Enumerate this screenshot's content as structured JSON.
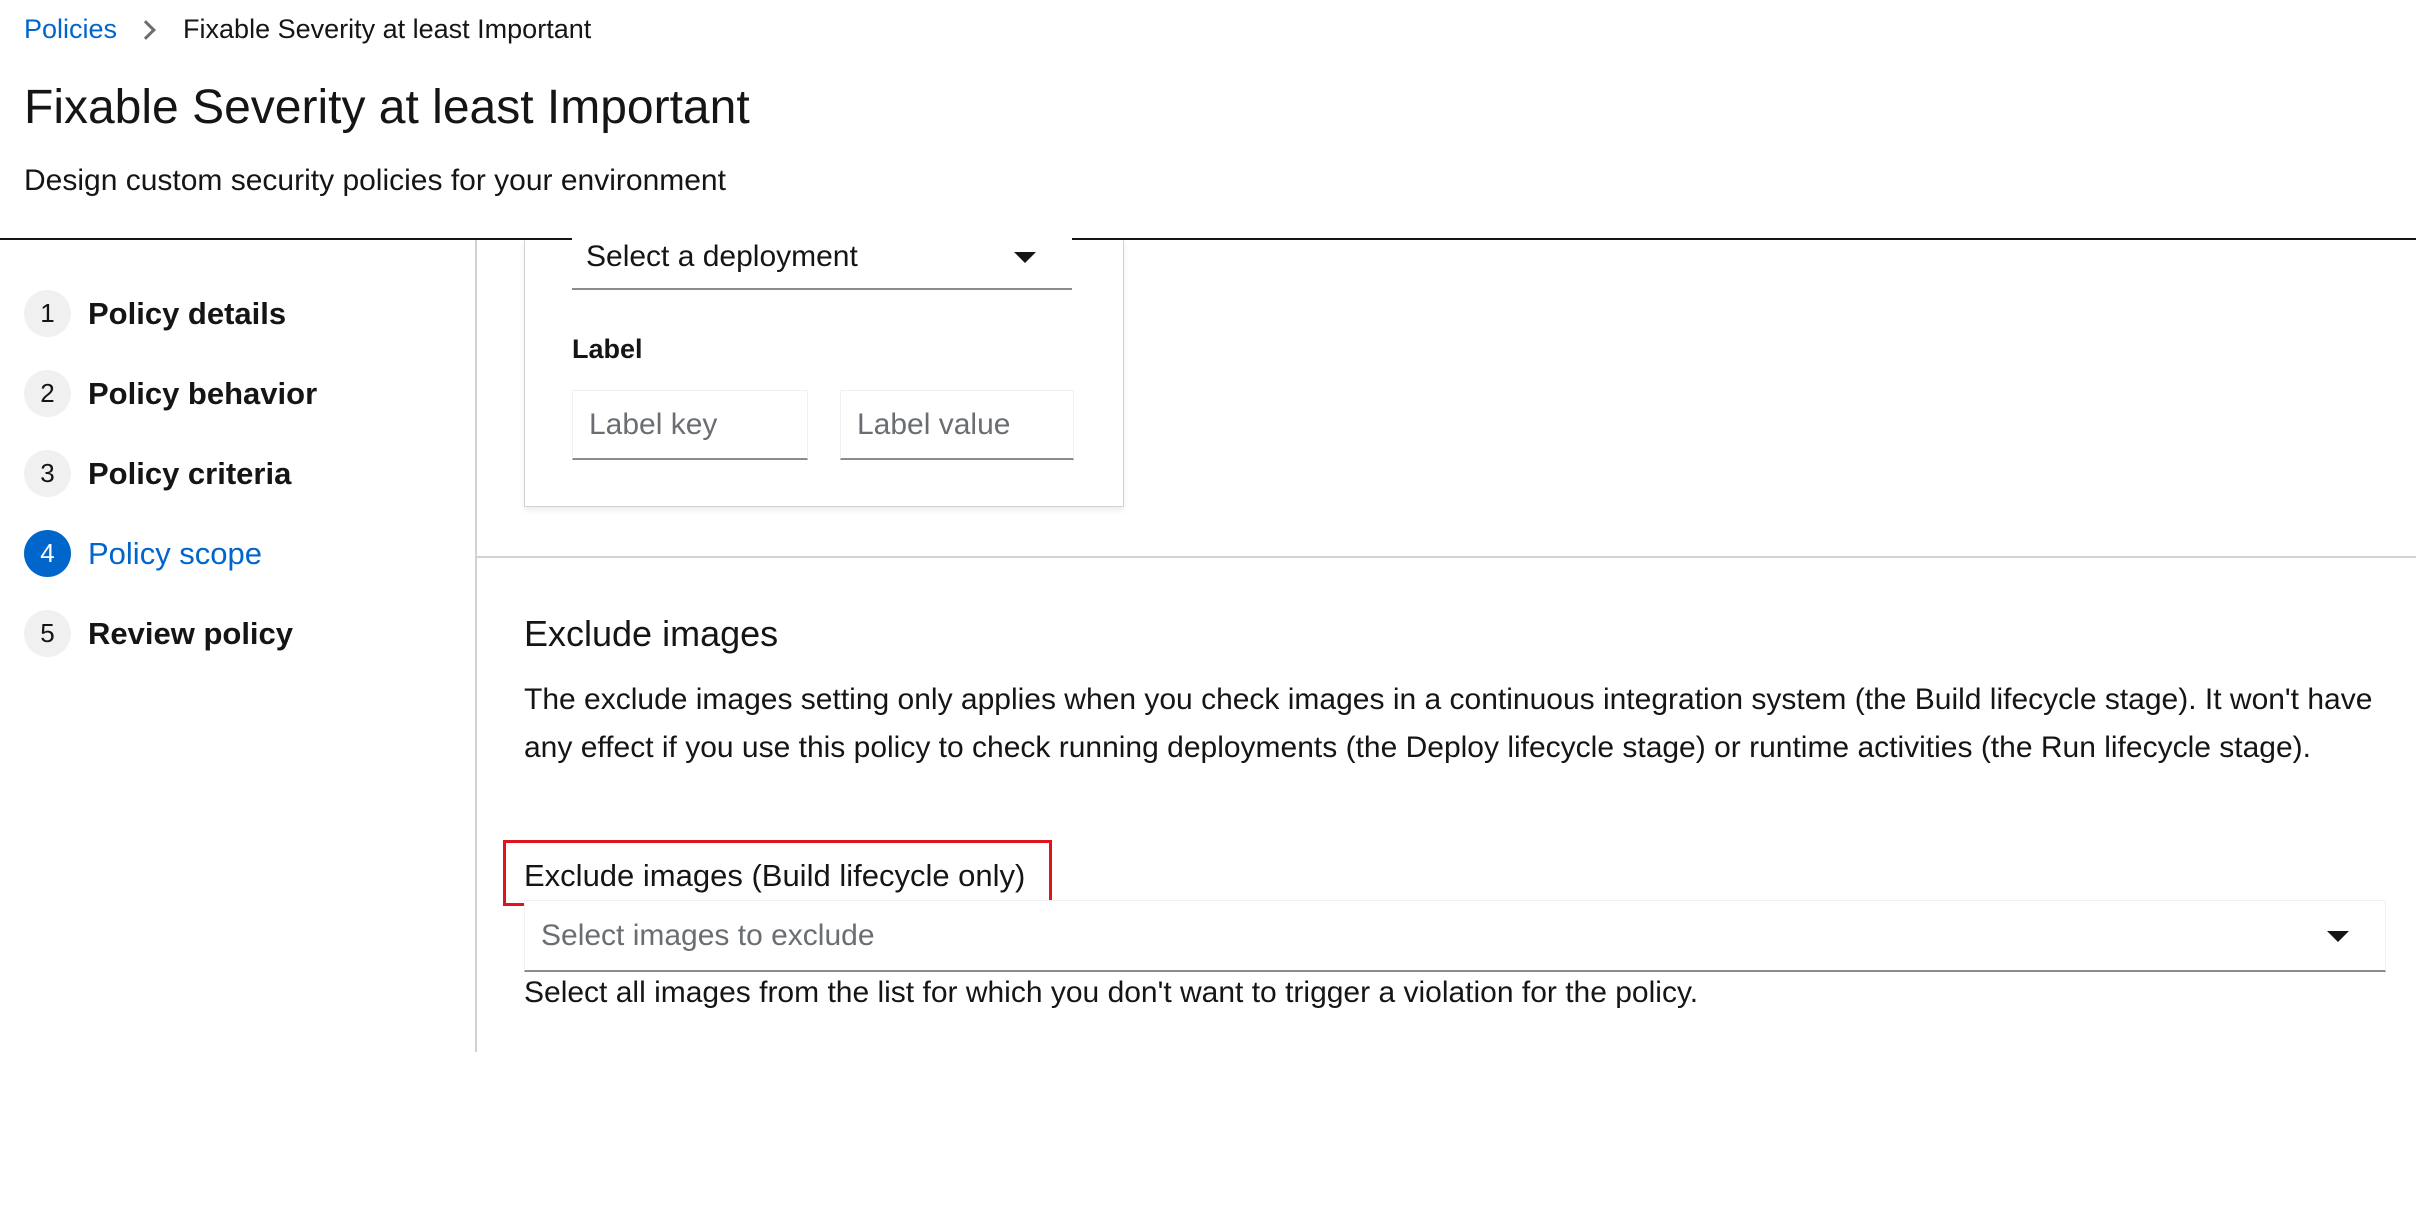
{
  "breadcrumb": {
    "parent": "Policies",
    "current": "Fixable Severity at least Important"
  },
  "header": {
    "title": "Fixable Severity at least Important",
    "description": "Design custom security policies for your environment"
  },
  "wizard_nav": {
    "items": [
      {
        "number": "1",
        "label": "Policy details"
      },
      {
        "number": "2",
        "label": "Policy behavior"
      },
      {
        "number": "3",
        "label": "Policy criteria"
      },
      {
        "number": "4",
        "label": "Policy scope",
        "active": true
      },
      {
        "number": "5",
        "label": "Review policy"
      }
    ]
  },
  "scope": {
    "deployment_select": "Select a deployment",
    "label_heading": "Label",
    "label_key_placeholder": "Label key",
    "label_value_placeholder": "Label value"
  },
  "exclude_images": {
    "title": "Exclude images",
    "description": "The exclude images setting only applies when you check images in a continuous integration system (the Build lifecycle stage). It won't have any effect if you use this policy to check running deployments (the Deploy lifecycle stage) or runtime activities (the Run lifecycle stage).",
    "field_label": "Exclude images (Build lifecycle only)",
    "select_placeholder": "Select images to exclude",
    "helper_text": "Select all images from the list for which you don't want to trigger a violation for the policy."
  },
  "colors": {
    "link": "#0066cc",
    "active_step": "#0066cc",
    "highlight": "#e0141e"
  }
}
